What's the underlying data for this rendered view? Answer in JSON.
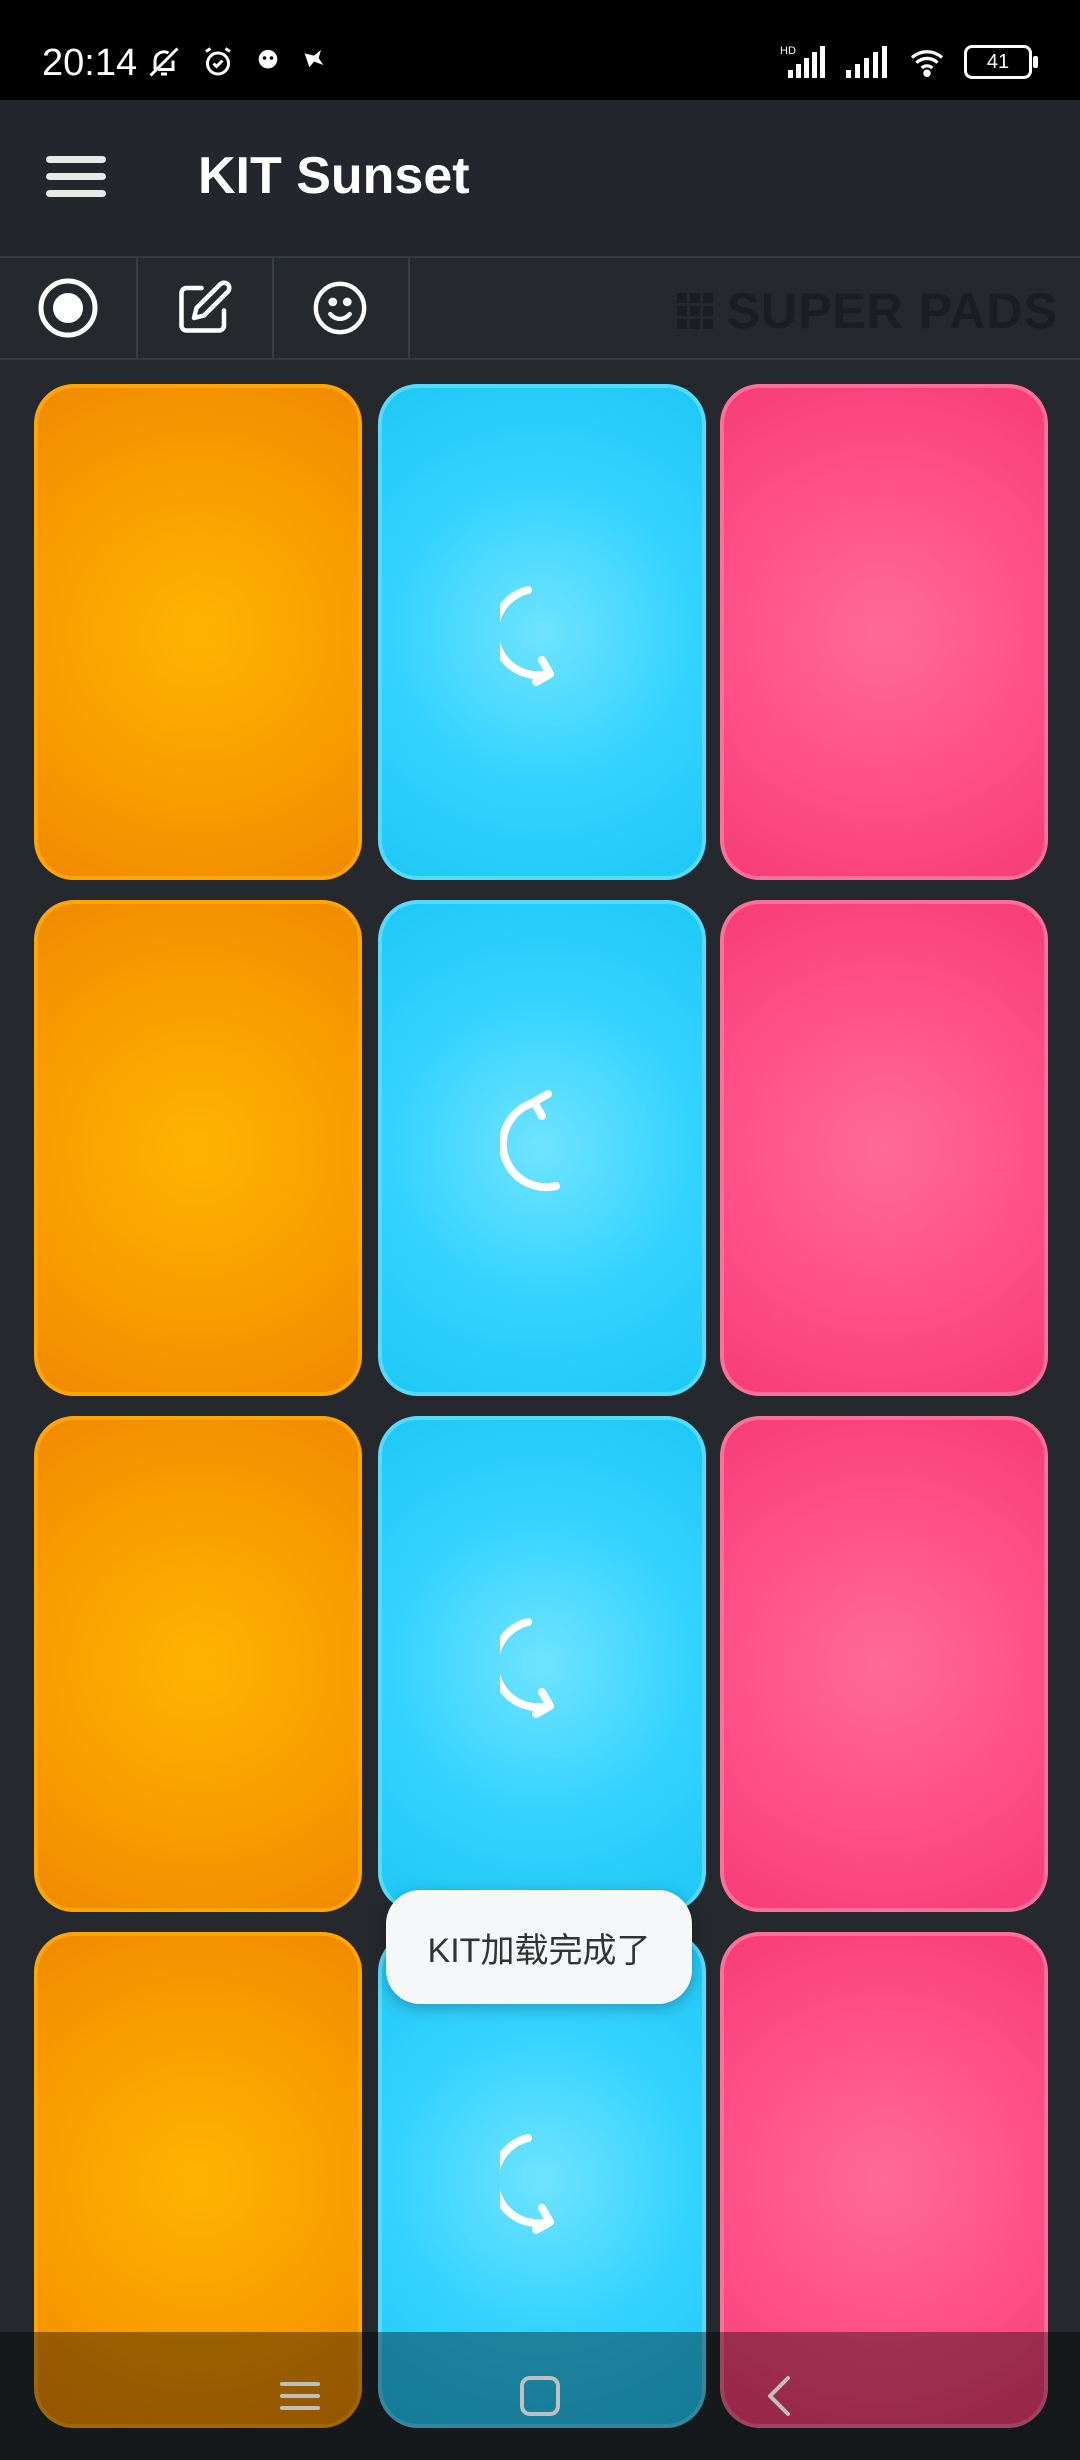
{
  "status_bar": {
    "time": "20:14",
    "battery": "41",
    "network_label": "HD"
  },
  "app_bar": {
    "title": "KIT Sunset"
  },
  "toolbar": {
    "brand": "SUPER PADS"
  },
  "pads": {
    "rows": 4,
    "columns": 3,
    "column_colors": [
      "#f99d00",
      "#35d3ff",
      "#ff4f88"
    ],
    "icons": [
      "",
      "refresh-ccw-icon",
      "",
      "",
      "refresh-cw-icon",
      "",
      "",
      "refresh-ccw-icon",
      "",
      "",
      "refresh-ccw-icon",
      ""
    ]
  },
  "toast": {
    "message": "KIT加载完成了"
  },
  "colors": {
    "background": "#25292e",
    "appbar": "#23272d",
    "orange": "#f99d00",
    "blue": "#35d3ff",
    "pink": "#ff4f88"
  }
}
